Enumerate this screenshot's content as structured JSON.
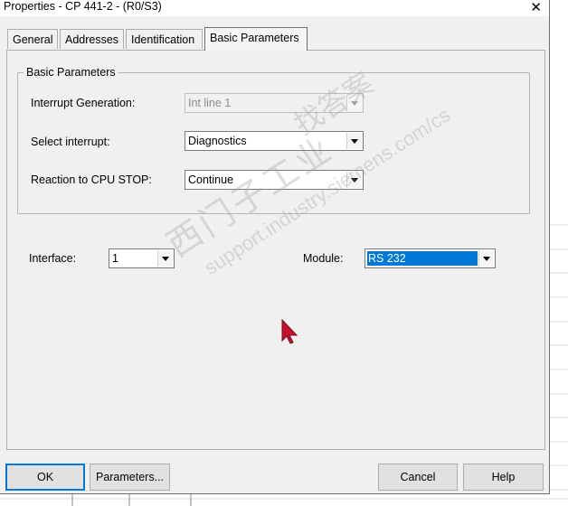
{
  "window": {
    "title": "Properties - CP 441-2 - (R0/S3)",
    "close_glyph": "✕"
  },
  "tabs": [
    {
      "label": "General",
      "active": false
    },
    {
      "label": "Addresses",
      "active": false
    },
    {
      "label": "Identification",
      "active": false
    },
    {
      "label": "Basic Parameters",
      "active": true
    }
  ],
  "group": {
    "title": "Basic Parameters",
    "interrupt_generation": {
      "label": "Interrupt Generation:",
      "value": "Int line 1",
      "enabled": false
    },
    "select_interrupt": {
      "label": "Select interrupt:",
      "value": "Diagnostics"
    },
    "reaction_cpu_stop": {
      "label": "Reaction to CPU STOP:",
      "value": "Continue"
    }
  },
  "interface": {
    "label": "Interface:",
    "value": "1"
  },
  "module": {
    "label": "Module:",
    "value": "RS 232"
  },
  "buttons": {
    "ok": "OK",
    "parameters": "Parameters...",
    "cancel": "Cancel",
    "help": "Help"
  },
  "watermark": {
    "line1": "西门子工业",
    "line2": "support.industry.siemens.com/cs",
    "line3": "找答案"
  },
  "colors": {
    "accent": "#0078d7",
    "dialog_bg": "#f0f0f0",
    "cursor": "#c8102e"
  }
}
